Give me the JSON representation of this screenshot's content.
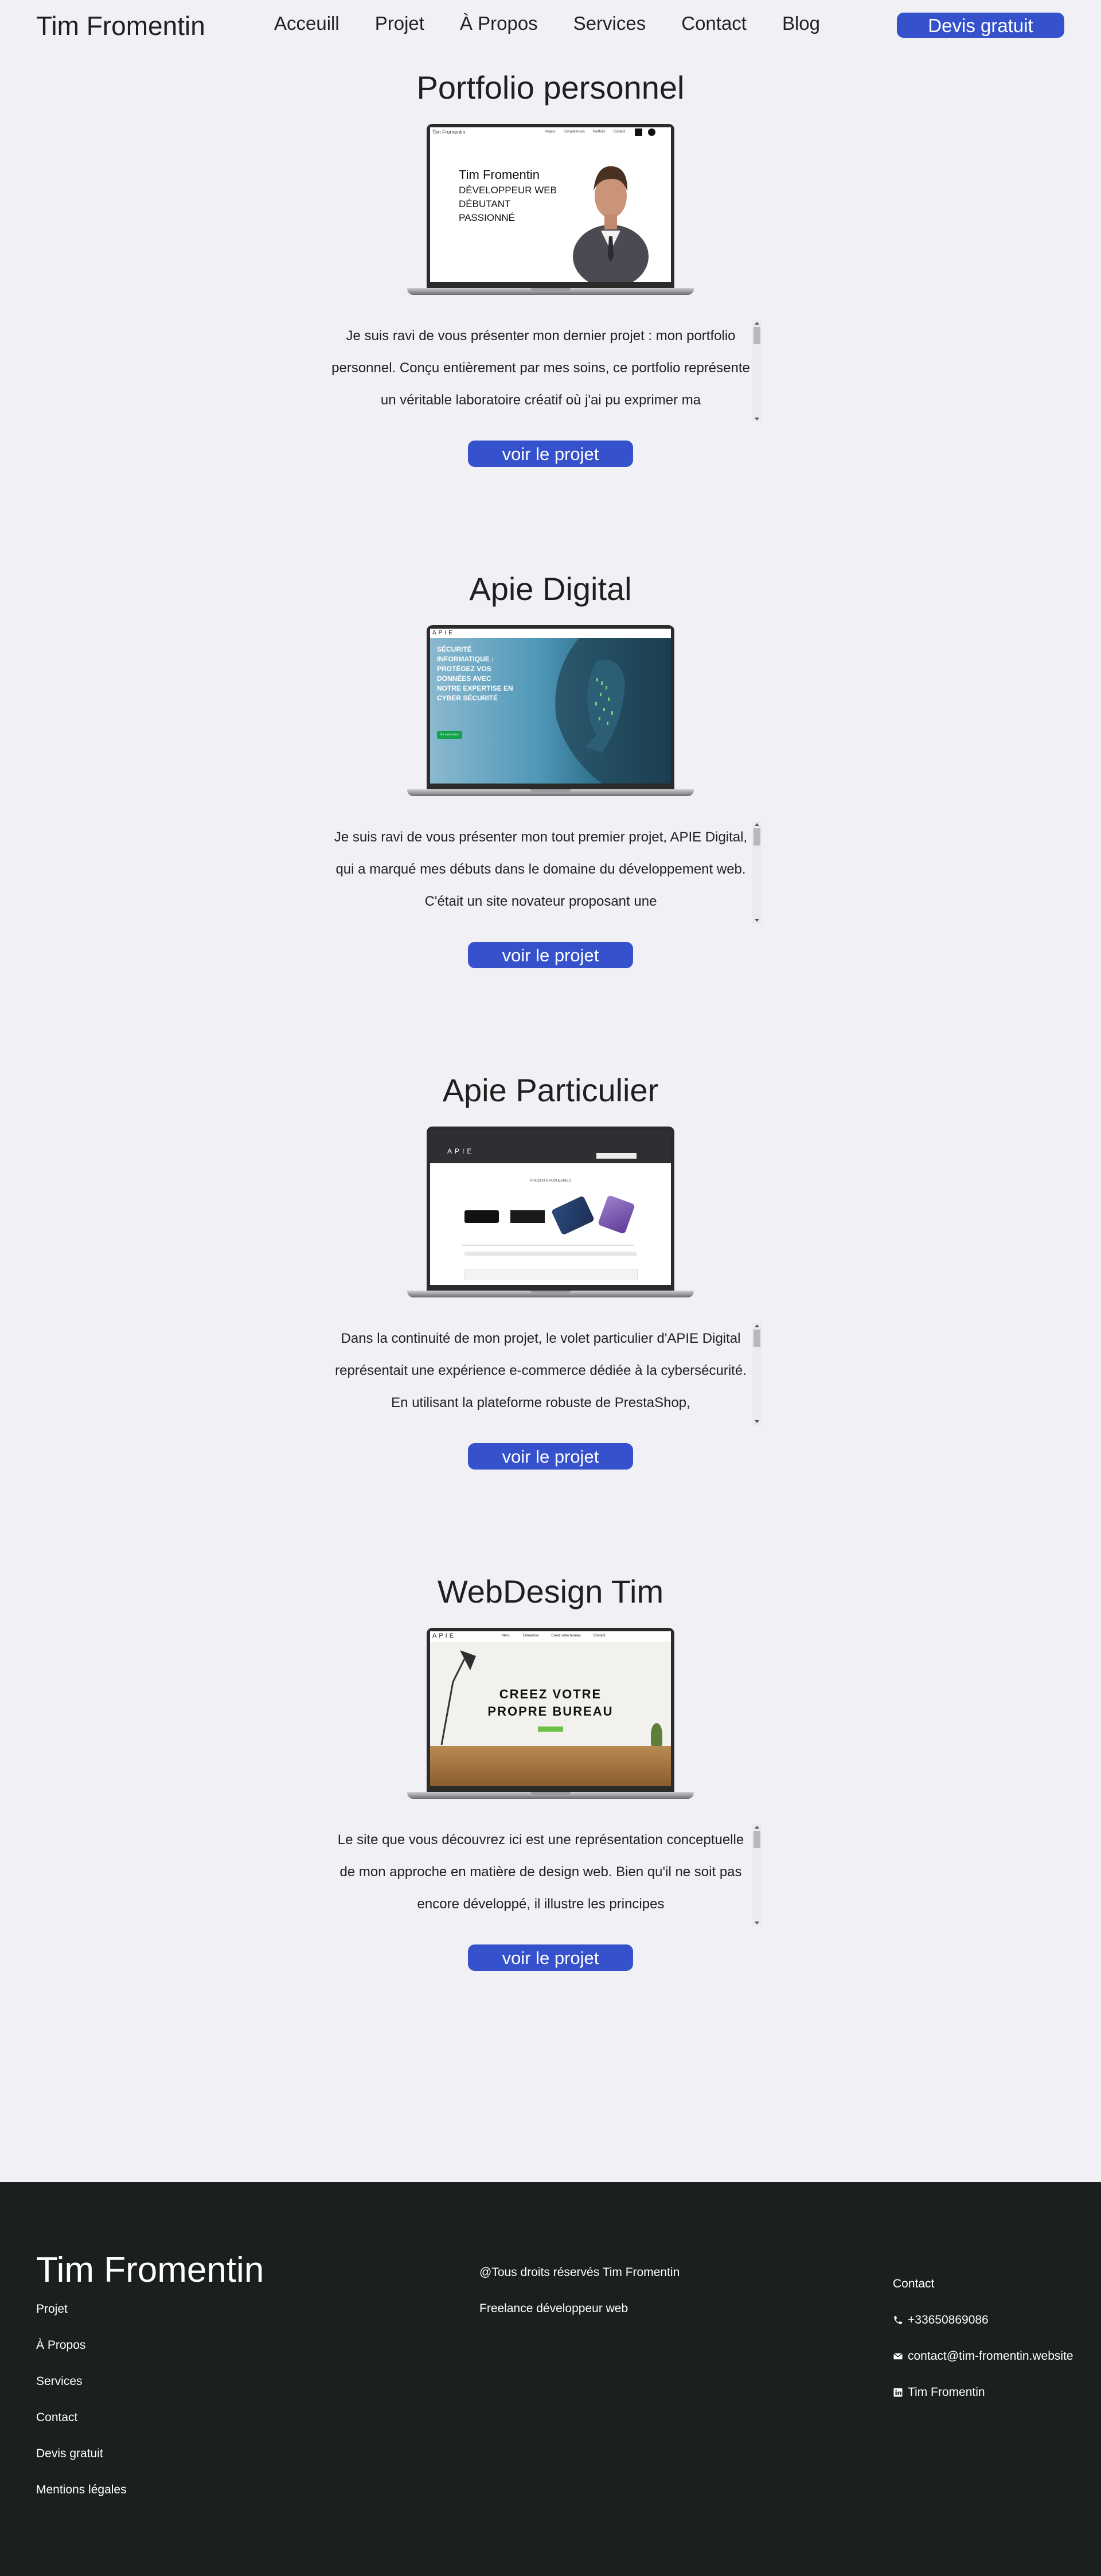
{
  "header": {
    "brand": "Tim Fromentin",
    "nav": [
      "Acceuill",
      "Projet",
      "À Propos",
      "Services",
      "Contact",
      "Blog"
    ],
    "cta": "Devis gratuit"
  },
  "projects": [
    {
      "title": "Portfolio personnel",
      "description": "Je suis ravi de vous présenter mon dernier projet : mon portfolio personnel. Conçu entièrement par mes soins, ce portfolio représente un véritable laboratoire créatif où j'ai pu exprimer ma",
      "button": "voir le projet",
      "screen": {
        "site_name": "Tim Fromentin",
        "menu": [
          "Projets",
          "Compétences",
          "Portfolio",
          "Contact"
        ],
        "hero_name": "Tim Fromentin",
        "hero_lines": [
          "DÉVELOPPEUR WEB",
          "DÉBUTANT",
          "PASSIONNÉ"
        ]
      }
    },
    {
      "title": "Apie Digital",
      "description": "Je suis ravi de vous présenter mon tout premier projet, APIE Digital, qui a marqué mes débuts dans le domaine du développement web. C'était un site novateur proposant une",
      "button": "voir le projet",
      "screen": {
        "logo": "APIE",
        "hero_lines": [
          "SÉCURITÉ",
          "INFORMATIQUE :",
          "PROTÉGEZ VOS",
          "DONNÉES AVEC",
          "NOTRE EXPERTISE EN",
          "CYBER SÉCURITÉ"
        ],
        "hero_button": "En savoir plus"
      }
    },
    {
      "title": "Apie Particulier",
      "description": "Dans la continuité de mon projet, le volet particulier d'APIE Digital représentait une expérience e-commerce dédiée à la cybersécurité. En utilisant la plateforme robuste de PrestaShop,",
      "button": "voir le projet",
      "screen": {
        "logo": "APIE",
        "section_title": "PRODUITS POPULAIRES"
      }
    },
    {
      "title": "WebDesign Tim",
      "description": "Le site que vous découvrez ici est une représentation conceptuelle de mon approche en matière de design web. Bien qu'il ne soit pas encore développé, il illustre les principes",
      "button": "voir le projet",
      "screen": {
        "logo": "APIE",
        "menu": [
          "Menu",
          "Entreprise",
          "Créez votre bureau",
          "Contact"
        ],
        "hero_lines": [
          "CREEZ VOTRE",
          "PROPRE BUREAU"
        ]
      }
    }
  ],
  "footer": {
    "brand": "Tim Fromentin",
    "links": [
      "Projet",
      "À Propos",
      "Services",
      "Contact",
      "Devis gratuit",
      "Mentions légales"
    ],
    "copyright": "@Tous droits réservés Tim Fromentin",
    "tagline": "Freelance développeur web",
    "contact_title": "Contact",
    "phone": "+33650869086",
    "email": "contact@tim-fromentin.website",
    "linkedin": "Tim Fromentin",
    "icons": [
      "phone-icon",
      "mail-icon",
      "linkedin-icon"
    ]
  },
  "colors": {
    "accent": "#3552cc",
    "background": "#f0f0f5",
    "footer_bg": "#1b1f20"
  }
}
